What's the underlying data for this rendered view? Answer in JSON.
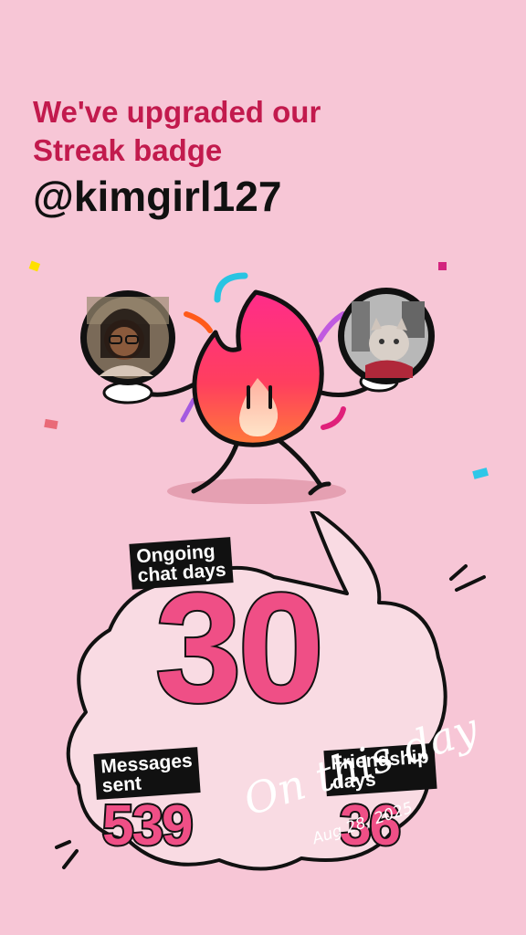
{
  "header": {
    "headline_line1": "We've upgraded our",
    "headline_line2": "Streak badge",
    "handle": "@kimgirl127"
  },
  "avatars": {
    "left": {
      "description_name": "user-avatar"
    },
    "right": {
      "description_name": "friend-avatar"
    }
  },
  "stats": {
    "ongoing_label": "Ongoing\nchat days",
    "ongoing_value": "30",
    "messages_label": "Messages\nsent",
    "messages_value": "539",
    "friendship_label": "Friendship\ndays",
    "friendship_value": "36"
  },
  "overlay": {
    "script_text": "On this day",
    "date_text": "Aug 28, 2025"
  },
  "colors": {
    "background": "#f7c6d6",
    "headline": "#c21a4d",
    "number": "#ef4f86",
    "cloud": "#f9dbe3"
  }
}
